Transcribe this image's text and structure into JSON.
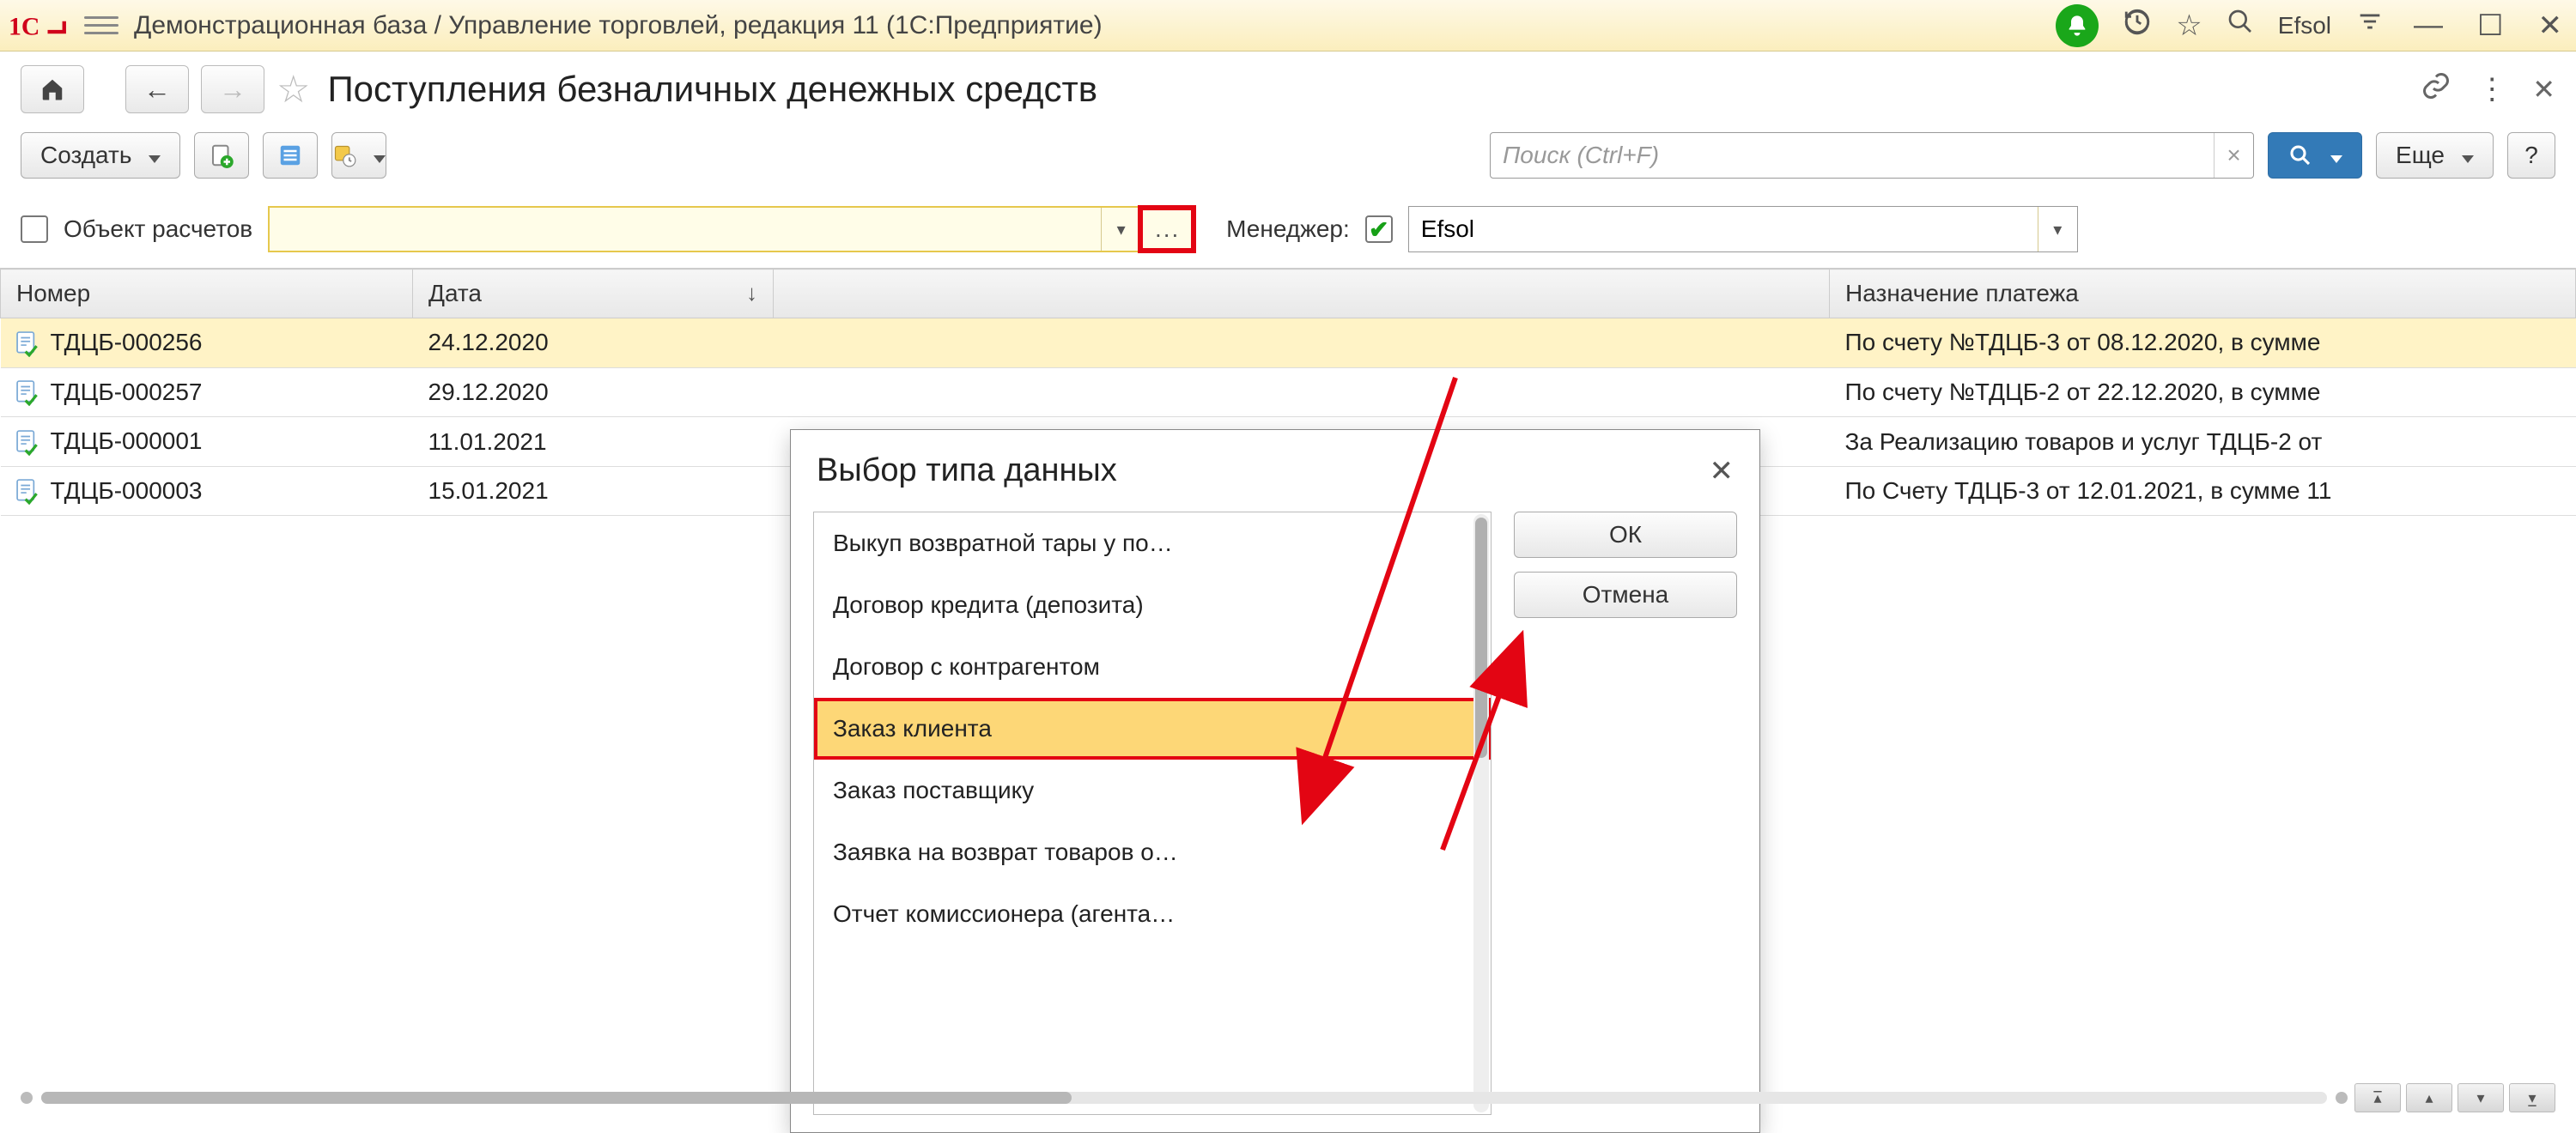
{
  "titlebar": {
    "app_title": "Демонстрационная база / Управление торговлей, редакция 11  (1С:Предприятие)",
    "username": "Efsol",
    "logo_text": "1@"
  },
  "page": {
    "title": "Поступления безналичных денежных средств"
  },
  "toolbar": {
    "create_label": "Создать",
    "search_placeholder": "Поиск (Ctrl+F)",
    "more_label": "Еще",
    "help_label": "?"
  },
  "filters": {
    "object_label": "Объект расчетов",
    "object_value": "",
    "object_ellipsis": "...",
    "manager_label": "Менеджер:",
    "manager_value": "Efsol"
  },
  "columns": {
    "number": "Номер",
    "date": "Дата",
    "purpose": "Назначение платежа"
  },
  "rows": [
    {
      "number": "ТДЦБ-000256",
      "date": "24.12.2020",
      "purpose": "По счету №ТДЦБ-3 от 08.12.2020, в сумме"
    },
    {
      "number": "ТДЦБ-000257",
      "date": "29.12.2020",
      "purpose": "По счету №ТДЦБ-2 от 22.12.2020, в сумме"
    },
    {
      "number": "ТДЦБ-000001",
      "date": "11.01.2021",
      "purpose": "За Реализацию товаров и услуг ТДЦБ-2 от"
    },
    {
      "number": "ТДЦБ-000003",
      "date": "15.01.2021",
      "purpose": "По Счету ТДЦБ-3 от 12.01.2021, в сумме 11"
    }
  ],
  "popup": {
    "title": "Выбор типа данных",
    "ok_label": "ОК",
    "cancel_label": "Отмена",
    "items": [
      "Выкуп возвратной тары у по…",
      "Договор кредита (депозита)",
      "Договор с контрагентом",
      "Заказ клиента",
      "Заказ поставщику",
      "Заявка на возврат товаров о…",
      "Отчет комиссионера (агента…"
    ],
    "selected_index": 3
  }
}
